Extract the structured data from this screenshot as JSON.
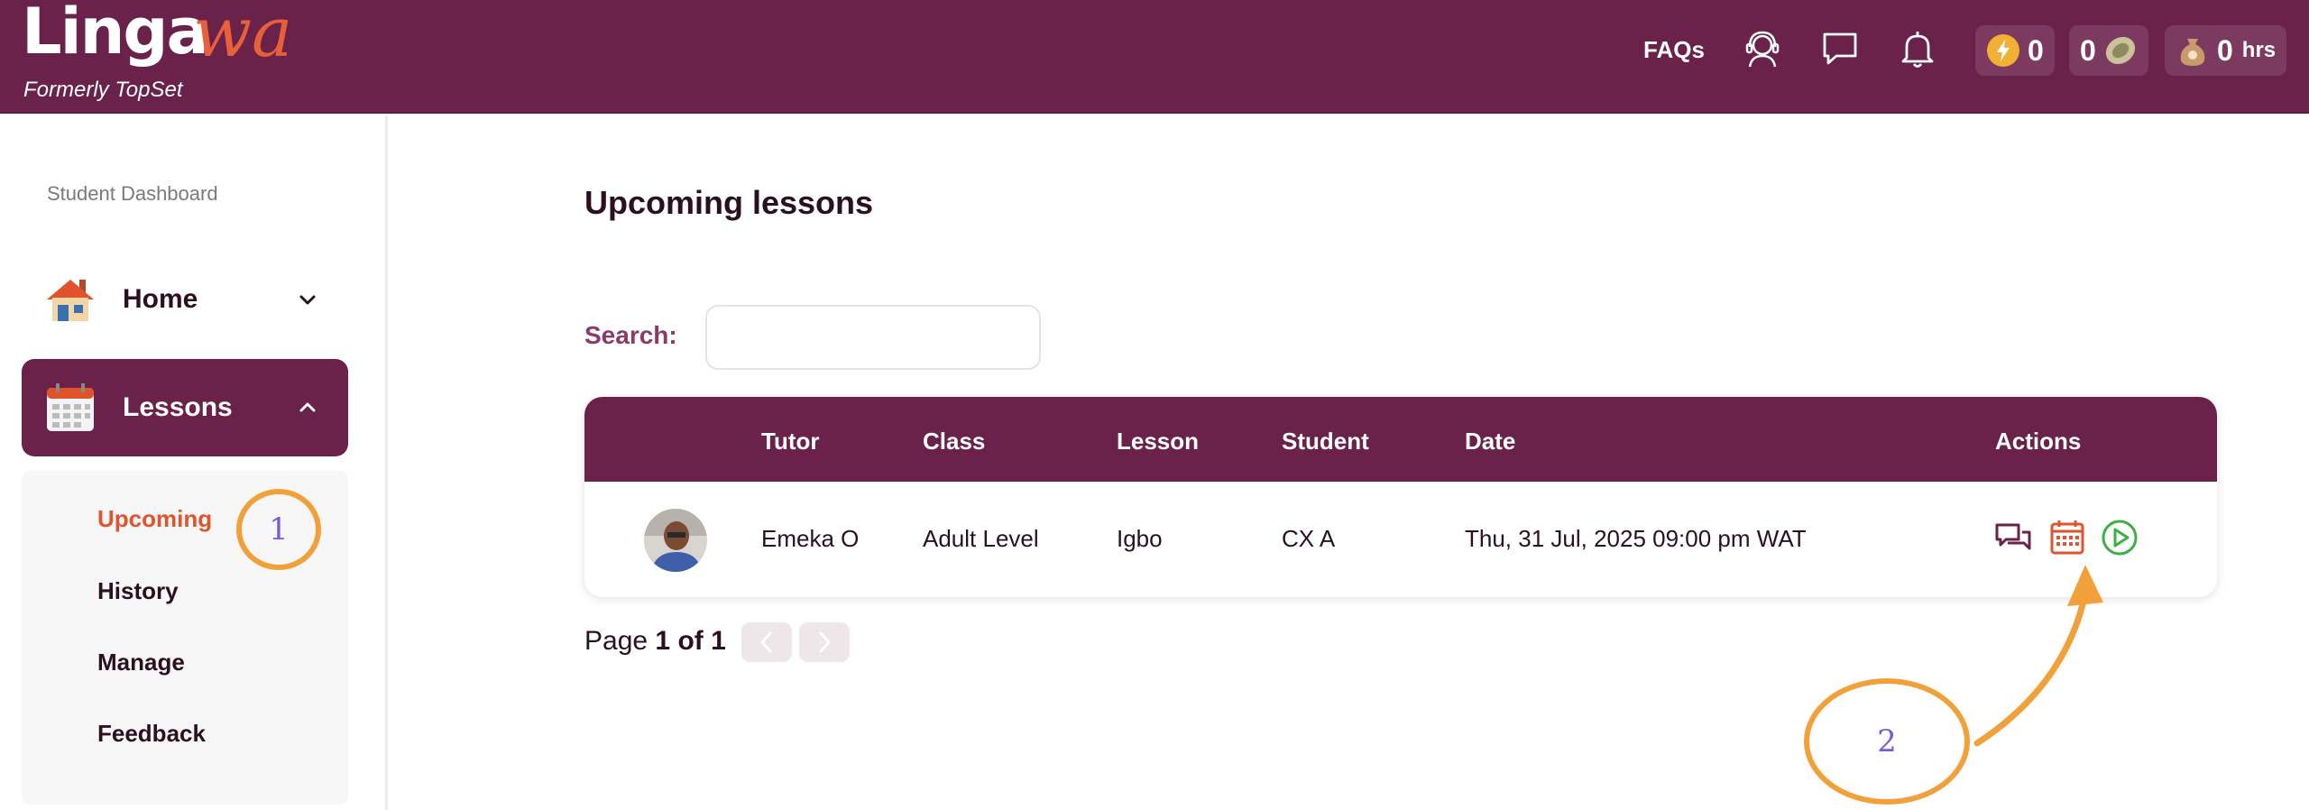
{
  "header": {
    "logo_main": "Linga",
    "logo_accent": "wa",
    "logo_sub": "Formerly TopSet",
    "faqs_label": "FAQs",
    "icons": [
      "support-agent-icon",
      "chat-icon",
      "bell-icon"
    ],
    "energy_count": "0",
    "coin_count": "0",
    "hours_count": "0",
    "hours_unit": "hrs"
  },
  "sidebar": {
    "title": "Student Dashboard",
    "home_label": "Home",
    "lessons_label": "Lessons",
    "submenu": [
      "Upcoming",
      "History",
      "Manage",
      "Feedback"
    ]
  },
  "main": {
    "title": "Upcoming lessons",
    "search_label": "Search:",
    "search_value": "",
    "columns": [
      "Tutor",
      "Class",
      "Lesson",
      "Student",
      "Date",
      "Actions"
    ],
    "rows": [
      {
        "tutor": "Emeka O",
        "class": "Adult Level",
        "lesson": "Igbo",
        "student": "CX A",
        "date": "Thu, 31 Jul, 2025 09:00 pm WAT"
      }
    ],
    "pager_prefix": "Page",
    "pager_value": "1 of 1"
  },
  "annotations": {
    "marker_1": "1",
    "marker_2": "2"
  },
  "colors": {
    "brand": "#6a214a",
    "accent": "#e0532b",
    "annotation": "#f2a03a"
  }
}
